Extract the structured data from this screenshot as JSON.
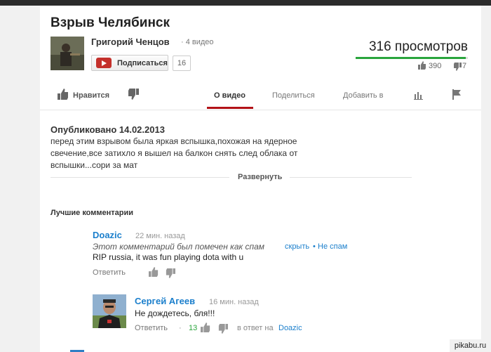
{
  "video": {
    "title": "Взрыв Челябинск",
    "channel_name": "Григорий Ченцов",
    "video_count": "· 4 видео",
    "subscribe_label": "Подписаться",
    "subscriber_count": "16",
    "views": "316 просмотров",
    "likes": "390",
    "dislikes": "7",
    "like_ratio": 0.98
  },
  "actions": {
    "like_label": "Нравится",
    "tab_about": "О видео",
    "tab_share": "Поделиться",
    "tab_add": "Добавить в"
  },
  "description": {
    "published": "Опубликовано 14.02.2013",
    "text": "перед этим взрывом была яркая вспышка,похожая на ядерное свечение,все затихло я вышел на балкон снять след облака от вспышки...сори за мат",
    "expand_label": "Развернуть"
  },
  "comments": {
    "section_title": "Лучшие комментарии",
    "items": [
      {
        "author": "Doazic",
        "time": "22 мин. назад",
        "flag_text": "Этот комментарий был помечен как спам",
        "show_label": "скрыть",
        "separator": "•",
        "not_spam_label": "Не спам",
        "text": "RIP russia, it was fun playing dota with u",
        "reply_label": "Ответить"
      },
      {
        "author": "Сергей Агеев",
        "time": "16 мин. назад",
        "text": "Не дождетесь, бля!!!",
        "reply_label": "Ответить",
        "separator": "·",
        "likes": "13",
        "in_reply_prefix": "в ответ на",
        "in_reply_to": "Doazic"
      }
    ]
  },
  "watermark": "pikabu.ru",
  "colors": {
    "accent": "#b31217",
    "link": "#1b7fcc",
    "like_green": "#2aa53d"
  }
}
